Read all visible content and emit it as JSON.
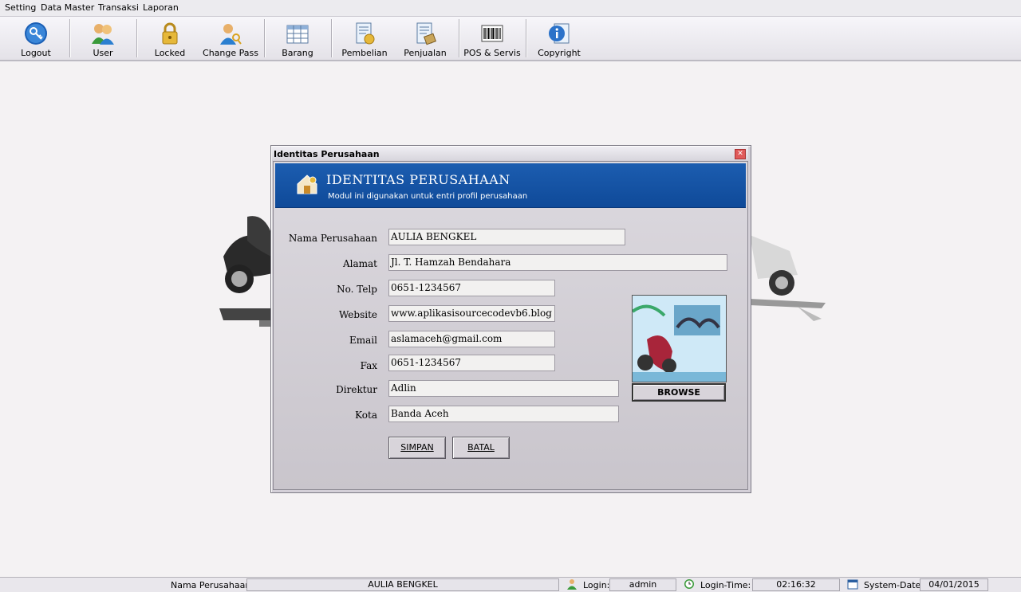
{
  "menu": [
    "Setting",
    "Data Master",
    "Transaksi",
    "Laporan"
  ],
  "toolbar": [
    {
      "label": "Logout",
      "icon": "logout-key-icon"
    },
    {
      "label": "User",
      "icon": "users-icon"
    },
    {
      "label": "Locked",
      "icon": "padlock-icon"
    },
    {
      "label": "Change Pass",
      "icon": "change-password-icon"
    },
    {
      "label": "Barang",
      "icon": "spreadsheet-icon"
    },
    {
      "label": "Pembelian",
      "icon": "purchase-document-icon"
    },
    {
      "label": "Penjualan",
      "icon": "sales-document-icon"
    },
    {
      "label": "POS & Servis",
      "icon": "barcode-icon"
    },
    {
      "label": "Copyright",
      "icon": "info-icon"
    }
  ],
  "dialog": {
    "title": "Identitas Perusahaan",
    "banner_title": "IDENTITAS PERUSAHAAN",
    "banner_subtitle": "Modul ini digunakan untuk entri profil perusahaan",
    "fields": {
      "nama_label": "Nama Perusahaan",
      "nama_value": "AULIA BENGKEL",
      "alamat_label": "Alamat",
      "alamat_value": "Jl. T. Hamzah Bendahara",
      "telp_label": "No. Telp",
      "telp_value": "0651-1234567",
      "website_label": "Website",
      "website_value": "www.aplikasisourcecodevb6.blog",
      "email_label": "Email",
      "email_value": "aslamaceh@gmail.com",
      "fax_label": "Fax",
      "fax_value": "0651-1234567",
      "direktur_label": "Direktur",
      "direktur_value": "Adlin",
      "kota_label": "Kota",
      "kota_value": "Banda Aceh"
    },
    "browse_label": "BROWSE",
    "simpan_label": "SIMPAN",
    "batal_label": "BATAL"
  },
  "status": {
    "company_label": "Nama Perusahaan",
    "company_value": "AULIA BENGKEL",
    "login_label": "Login:",
    "login_value": "admin",
    "login_time_label": "Login-Time:",
    "login_time_value": "02:16:32",
    "system_date_label": "System-Date:",
    "system_date_value": "04/01/2015"
  },
  "colors": {
    "banner": "#1458a8",
    "dialog_bg": "#d4d0d8",
    "close_button": "#e05a5a"
  }
}
